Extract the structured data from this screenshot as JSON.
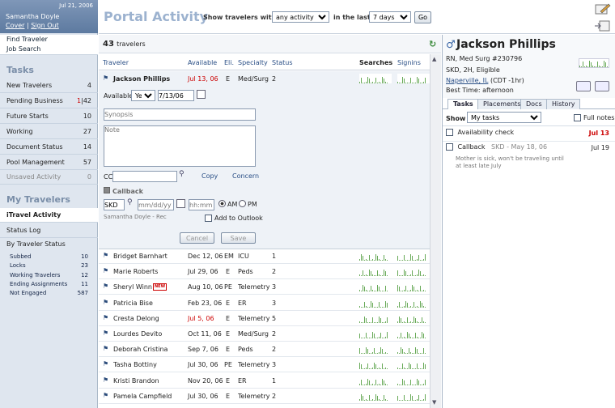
{
  "app": {
    "title": "Portal Activity"
  },
  "user": {
    "date": "Jul 21, 2006",
    "name": "Samantha Doyle",
    "cover": "Cover",
    "separator": "|",
    "sign_out": "Sign Out"
  },
  "sidebar": {
    "quick_links": [
      "Find Traveler",
      "Job Search"
    ],
    "tasks_title": "Tasks",
    "tasks": [
      {
        "label": "New Travelers",
        "count": "4"
      },
      {
        "label": "Pending Business",
        "count_red": "1",
        "count_sep": "|",
        "count": "42"
      },
      {
        "label": "Future Starts",
        "count": "10"
      },
      {
        "label": "Working",
        "count": "27"
      },
      {
        "label": "Document Status",
        "count": "14"
      },
      {
        "label": "Pool Management",
        "count": "57"
      },
      {
        "label": "Unsaved Activity",
        "count": "0"
      }
    ],
    "my_travelers_title": "My Travelers",
    "nav": [
      "iTravel Activity",
      "Status Log",
      "By Traveler Status"
    ],
    "status_items": [
      {
        "label": "Subbed",
        "count": "10"
      },
      {
        "label": "Locks",
        "count": "23"
      },
      {
        "label": "Working Travelers",
        "count": "12"
      },
      {
        "label": "Ending Assignments",
        "count": "11"
      },
      {
        "label": "Not Engaged",
        "count": "587"
      }
    ]
  },
  "filter": {
    "show_label": "Show travelers with",
    "activity_value": "any activity",
    "in_last_label": "in the last",
    "period_value": "7 days",
    "go_label": "Go"
  },
  "list": {
    "count": "43",
    "count_label": "travelers",
    "columns": [
      "Traveler",
      "Available",
      "Eli.",
      "Specialty",
      "Status",
      "Searches",
      "Signins"
    ],
    "selected": {
      "name": "Jackson Phillips",
      "available": "Jul 13, 06",
      "eli": "E",
      "specialty": "Med/Surg",
      "status": "2"
    },
    "rows": [
      {
        "name": "Bridget Barnhart",
        "available": "Dec 12, 06",
        "eli": "EM",
        "specialty": "ICU",
        "status": "1",
        "red": false
      },
      {
        "name": "Marie Roberts",
        "available": "Jul 29, 06",
        "eli": "E",
        "specialty": "Peds",
        "status": "2",
        "red": false
      },
      {
        "name": "Sheryl Winn",
        "badge": "NEW",
        "available": "Aug 10, 06",
        "eli": "PE",
        "specialty": "Telemetry",
        "status": "3",
        "red": false
      },
      {
        "name": "Patricia Bise",
        "available": "Feb 23, 06",
        "eli": "E",
        "specialty": "ER",
        "status": "3",
        "red": false
      },
      {
        "name": "Cresta Delong",
        "available": "Jul 5, 06",
        "eli": "E",
        "specialty": "Telemetry",
        "status": "5",
        "red": true
      },
      {
        "name": "Lourdes Devito",
        "available": "Oct 11, 06",
        "eli": "E",
        "specialty": "Med/Surg",
        "status": "2",
        "red": false
      },
      {
        "name": "Deborah Cristina",
        "available": "Sep 7, 06",
        "eli": "E",
        "specialty": "Peds",
        "status": "2",
        "red": false
      },
      {
        "name": "Tasha Bottiny",
        "available": "Jul 30, 06",
        "eli": "PE",
        "specialty": "Telemetry",
        "status": "3",
        "red": false
      },
      {
        "name": "Kristi Brandon",
        "available": "Nov 20, 06",
        "eli": "E",
        "specialty": "ER",
        "status": "1",
        "red": false
      },
      {
        "name": "Pamela Campfield",
        "available": "Jul 30, 06",
        "eli": "E",
        "specialty": "Telemetry",
        "status": "2",
        "red": false
      }
    ]
  },
  "activity_form": {
    "available_label": "Available",
    "available_value": "Yes",
    "available_date": "7/13/06",
    "synopsis_placeholder": "Synopsis",
    "note_placeholder": "Note",
    "cc_label": "CC",
    "copy_label": "Copy",
    "concern_label": "Concern",
    "callback_label": "Callback",
    "callback_initials": "SKD",
    "date_placeholder": "mm/dd/yy",
    "time_placeholder": "hh:mm",
    "am_label": "AM",
    "pm_label": "PM",
    "recruiter": "Samantha Doyle - Rec",
    "add_outlook_label": "Add to Outlook",
    "cancel_label": "Cancel",
    "save_label": "Save"
  },
  "profile": {
    "name": "Jackson Phillips",
    "line1": "RN, Med Surg #230796",
    "line2": "SKD, 2H, Eligible",
    "location": "Naperville, IL",
    "timezone": "(CDT -1hr)",
    "best_time": "Best Time: afternoon",
    "tabs": [
      "Tasks",
      "Placements",
      "Docs",
      "History"
    ],
    "show_label": "Show",
    "show_value": "My tasks",
    "full_notes_label": "Full notes",
    "tasks": [
      {
        "title": "Availability check",
        "meta": "",
        "date": "Jul 13",
        "red": true
      },
      {
        "title": "Callback",
        "meta": "SKD - May 18, 06",
        "date": "Jul 19",
        "red": false,
        "note": "Mother is sick, won't be traveling until at least late July"
      }
    ]
  },
  "colors": {
    "accent": "#9cb2cf",
    "link": "#2a4f86",
    "alert": "#cc0000",
    "spark": "#67a957"
  }
}
